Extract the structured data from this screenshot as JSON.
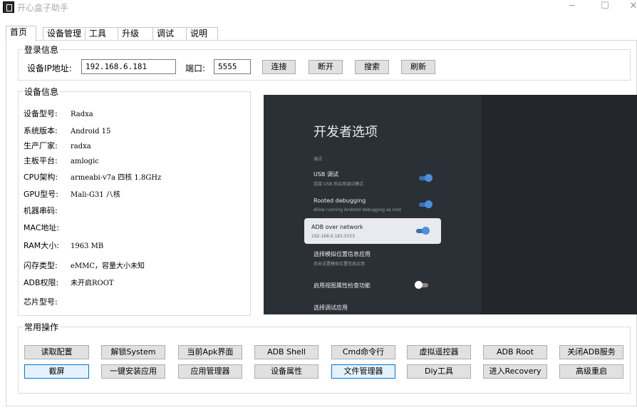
{
  "window": {
    "title": "开心盒子助手",
    "controls": [
      "─",
      "☐",
      "✕"
    ]
  },
  "tabs": [
    "首页",
    "设备管理",
    "工具箱",
    "升级",
    "调试",
    "说明"
  ],
  "login": {
    "group_label": "登录信息",
    "ip_label": "设备IP地址:",
    "ip_value": "192.168.6.181",
    "port_label": "端口:",
    "port_value": "5555",
    "buttons": [
      "连接",
      "断开",
      "搜索",
      "刷新"
    ]
  },
  "device": {
    "group_label": "设备信息",
    "rows": [
      {
        "k": "设备型号:",
        "v": "Radxa"
      },
      {
        "k": "系统版本:",
        "v": "Android 15"
      },
      {
        "k": "生产厂家:",
        "v": "radxa"
      },
      {
        "k": "主板平台:",
        "v": "amlogic"
      },
      {
        "k": "CPU架构:",
        "v": "armeabi-v7a 四核 1.8GHz"
      },
      {
        "k": "GPU型号:",
        "v": "Mali-G31 八核"
      },
      {
        "k": "机器串码:",
        "v": ""
      },
      {
        "k": "MAC地址:",
        "v": ""
      },
      {
        "k": "RAM大小:",
        "v": "1963 MB"
      },
      {
        "k": "闪存类型:",
        "v": "eMMC，容量大小未知"
      },
      {
        "k": "ADB权限:",
        "v": "未开启ROOT"
      },
      {
        "k": "芯片型号:",
        "v": ""
      }
    ]
  },
  "screen": {
    "title": "开发者选项",
    "section": "调试",
    "items": [
      {
        "title": "USB 调试",
        "sub": "连接 USB 后启用调试模式"
      },
      {
        "title": "Rooted debugging",
        "sub": "Allow running Android debugging as root"
      },
      {
        "title": "ADB over network",
        "sub": "192.168.6.181:5555"
      },
      {
        "title": "选择模拟位置信息应用",
        "sub": "尚未设置模拟位置信息应用"
      },
      {
        "title": "启用视图属性检查功能",
        "sub": ""
      },
      {
        "title": "选择调试应用",
        "sub": ""
      }
    ]
  },
  "ops": {
    "group_label": "常用操作",
    "row1": [
      "读取配置",
      "解锁System",
      "当前Apk界面",
      "ADB Shell",
      "Cmd命令行",
      "虚拟遥控器",
      "ADB  Root",
      "关闭ADB服务"
    ],
    "row2": [
      "截屏",
      "一键安装应用",
      "应用管理器",
      "设备属性",
      "文件管理器",
      "Diy工具",
      "进入Recovery",
      "高级重启"
    ]
  }
}
